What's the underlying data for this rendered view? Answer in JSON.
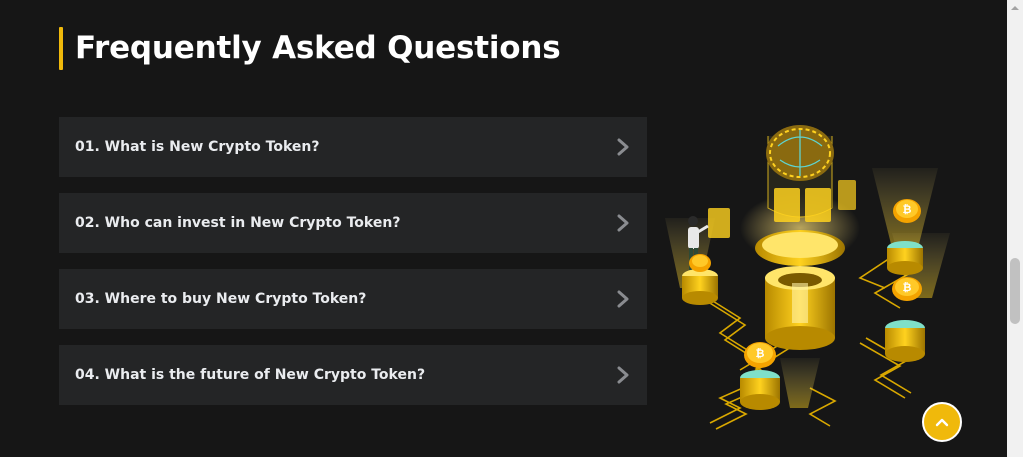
{
  "section": {
    "title": "Frequently Asked Questions",
    "accent_color": "#f0b90b"
  },
  "faq": [
    {
      "question": "01. What is New Crypto Token?",
      "icon": "chevron-right-icon"
    },
    {
      "question": "02. Who can invest in New Crypto Token?",
      "icon": "chevron-right-icon"
    },
    {
      "question": "03. Where to buy New Crypto Token?",
      "icon": "chevron-right-icon"
    },
    {
      "question": "04. What is the future of New Crypto Token?",
      "icon": "chevron-right-icon"
    }
  ],
  "illustration": {
    "subject": "isometric crypto platform with brain core, coins and investor"
  },
  "back_to_top": {
    "icon": "chevron-up-icon"
  },
  "colors": {
    "background": "#161616",
    "card": "#242526",
    "text": "#eaecef",
    "accent": "#f0b90b"
  }
}
